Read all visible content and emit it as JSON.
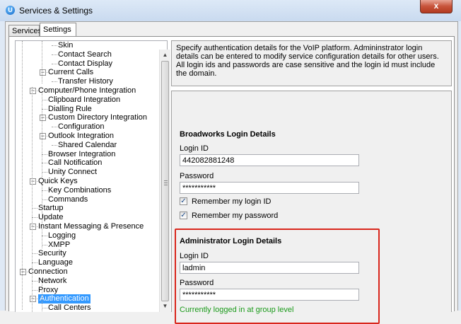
{
  "window": {
    "title": "Services & Settings",
    "close_glyph": "x"
  },
  "tabs": [
    {
      "label": "Services",
      "active": false
    },
    {
      "label": "Settings",
      "active": true
    }
  ],
  "tree": {
    "items": [
      {
        "label": "Skin",
        "selected": false
      },
      {
        "label": "Contact Search",
        "selected": false
      },
      {
        "label": "Contact Display",
        "selected": false
      },
      {
        "label": "Current Calls",
        "selected": false,
        "expander": "−"
      },
      {
        "label": "Transfer History",
        "selected": false
      },
      {
        "label": "Computer/Phone Integration",
        "selected": false,
        "expander": "−"
      },
      {
        "label": "Clipboard Integration",
        "selected": false
      },
      {
        "label": "Dialling Rule",
        "selected": false
      },
      {
        "label": "Custom Directory Integration",
        "selected": false,
        "expander": "−"
      },
      {
        "label": "Configuration",
        "selected": false
      },
      {
        "label": "Outlook Integration",
        "selected": false,
        "expander": "−"
      },
      {
        "label": "Shared Calendar",
        "selected": false
      },
      {
        "label": "Browser Integration",
        "selected": false
      },
      {
        "label": "Call Notification",
        "selected": false
      },
      {
        "label": "Unity Connect",
        "selected": false
      },
      {
        "label": "Quick Keys",
        "selected": false,
        "expander": "−"
      },
      {
        "label": "Key Combinations",
        "selected": false
      },
      {
        "label": "Commands",
        "selected": false
      },
      {
        "label": "Startup",
        "selected": false
      },
      {
        "label": "Update",
        "selected": false
      },
      {
        "label": "Instant Messaging & Presence",
        "selected": false,
        "expander": "−"
      },
      {
        "label": "Logging",
        "selected": false
      },
      {
        "label": "XMPP",
        "selected": false
      },
      {
        "label": "Security",
        "selected": false
      },
      {
        "label": "Language",
        "selected": false
      },
      {
        "label": "Connection",
        "selected": false,
        "expander": "−"
      },
      {
        "label": "Network",
        "selected": false
      },
      {
        "label": "Proxy",
        "selected": false
      },
      {
        "label": "Authentication",
        "selected": true,
        "expander": "−"
      },
      {
        "label": "Call Centers",
        "selected": false
      }
    ]
  },
  "description": "Specify authentication details for the VoIP platform.  Admininstrator login details can be entered to modify service configuration details for other users.  All login ids and passwords are case sensitive and the login id must include the domain.",
  "broadworks": {
    "title": "Broadworks Login Details",
    "login_id_label": "Login ID",
    "login_id_value": "442082881248",
    "password_label": "Password",
    "password_value": "***********",
    "remember_login_label": "Remember my login ID",
    "remember_login_checked": true,
    "remember_password_label": "Remember my password",
    "remember_password_checked": true
  },
  "administrator": {
    "title": "Administrator Login Details",
    "login_id_label": "Login ID",
    "login_id_value": "ladmin",
    "password_label": "Password",
    "password_value": "***********",
    "status": "Currently logged in at group level",
    "status_color": "#1a9a1a",
    "highlight_color": "#d9261c"
  },
  "icons": {
    "app": "app-logo-icon",
    "close": "close-icon",
    "check": "✓",
    "scroll_up": "▲",
    "scroll_down": "▼"
  }
}
